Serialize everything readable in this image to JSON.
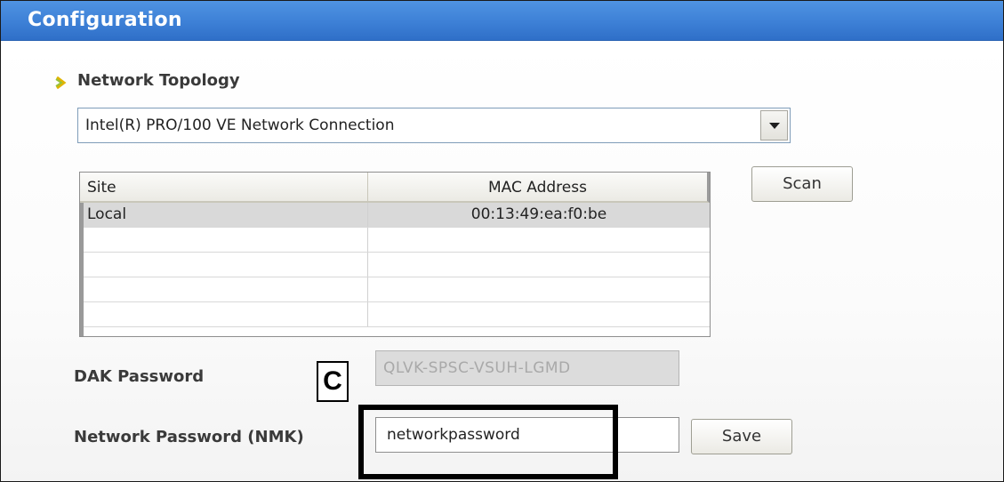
{
  "window": {
    "title": "Configuration"
  },
  "section": {
    "title": "Network Topology",
    "icon": "arrow-icon"
  },
  "adapter_dropdown": {
    "value": "Intel(R) PRO/100 VE Network Connection"
  },
  "table": {
    "headers": {
      "site": "Site",
      "mac": "MAC Address"
    },
    "rows": [
      {
        "site": "Local",
        "mac": "00:13:49:ea:f0:be",
        "selected": true
      },
      {
        "site": "",
        "mac": ""
      },
      {
        "site": "",
        "mac": ""
      },
      {
        "site": "",
        "mac": ""
      },
      {
        "site": "",
        "mac": ""
      }
    ]
  },
  "buttons": {
    "scan": "Scan",
    "save": "Save"
  },
  "dak": {
    "label": "DAK Password",
    "value": "QLVK-SPSC-VSUH-LGMD"
  },
  "nmk": {
    "label": "Network Password (NMK)",
    "value": "networkpassword"
  },
  "callout": {
    "letter": "C"
  },
  "colors": {
    "title_bar": "#3d80d6",
    "highlight_border": "#000000"
  }
}
